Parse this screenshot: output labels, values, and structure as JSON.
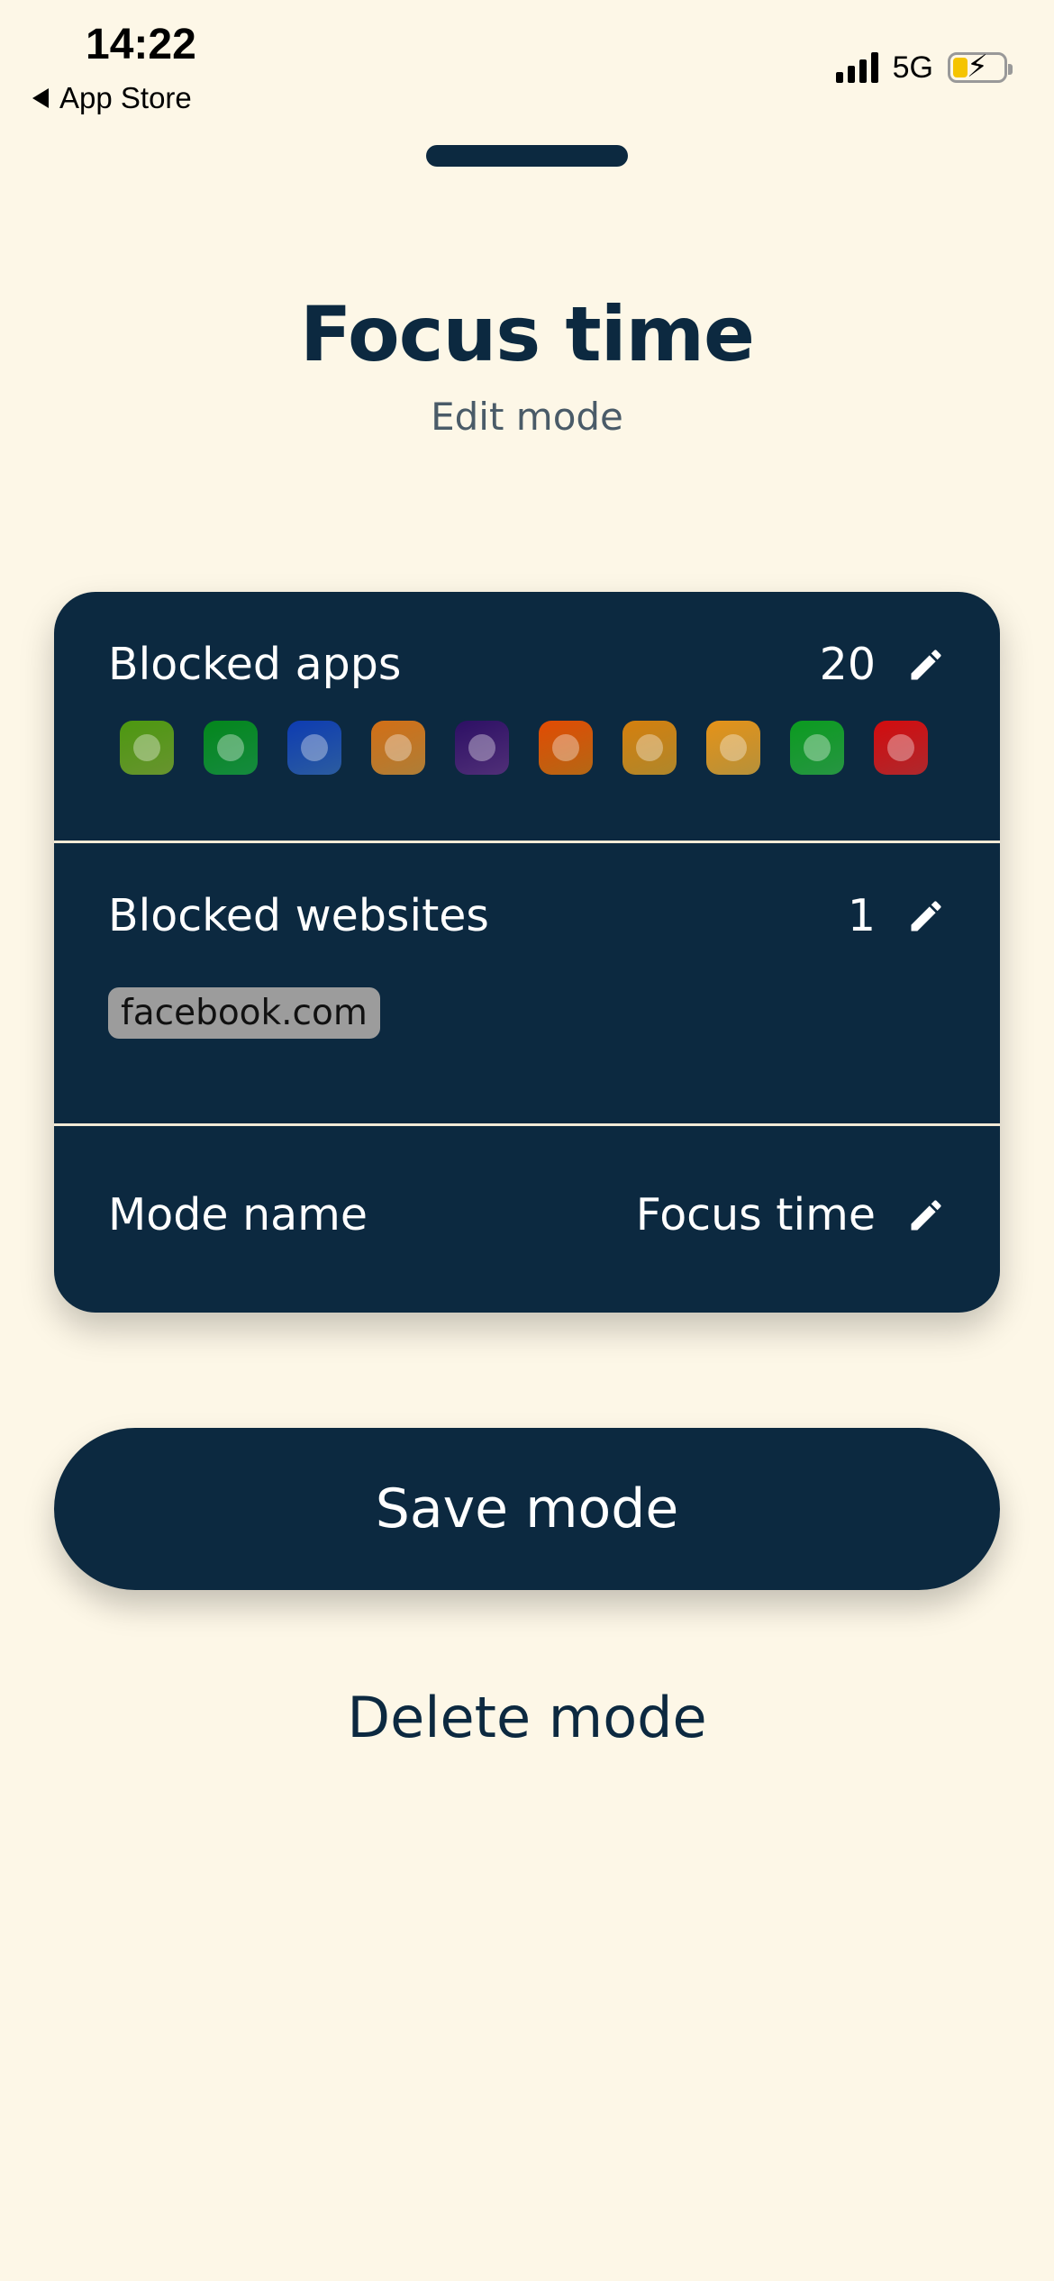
{
  "status_bar": {
    "time": "14:22",
    "back_label": "App Store",
    "network": "5G",
    "battery_level": 0.3
  },
  "header": {
    "title": "Focus time",
    "subtitle": "Edit mode"
  },
  "card": {
    "blocked_apps": {
      "label": "Blocked apps",
      "count": "20",
      "icons": [
        {
          "name": "talking-tom-icon",
          "color": "#8bc53f"
        },
        {
          "name": "spotify-icon",
          "color": "#1db954"
        },
        {
          "name": "clash-royale-icon",
          "color": "#3a7bd5"
        },
        {
          "name": "gofko-icon",
          "color": "#e8a84a"
        },
        {
          "name": "clash-of-clans-icon",
          "color": "#6b3fa0"
        },
        {
          "name": "brawl-stars-icon",
          "color": "#f08a1c"
        },
        {
          "name": "game-icon",
          "color": "#e9b43a"
        },
        {
          "name": "characters-icon",
          "color": "#f2c14e"
        },
        {
          "name": "facetime-icon",
          "color": "#34c759"
        },
        {
          "name": "rocket-icon",
          "color": "#e8363c"
        }
      ]
    },
    "blocked_websites": {
      "label": "Blocked websites",
      "count": "1",
      "sites": [
        "facebook.com"
      ]
    },
    "mode_name": {
      "label": "Mode name",
      "value": "Focus time"
    }
  },
  "actions": {
    "save_label": "Save mode",
    "delete_label": "Delete mode"
  },
  "colors": {
    "background": "#fdf7e7",
    "navy": "#0c2940",
    "chip": "#9c9c9c"
  }
}
